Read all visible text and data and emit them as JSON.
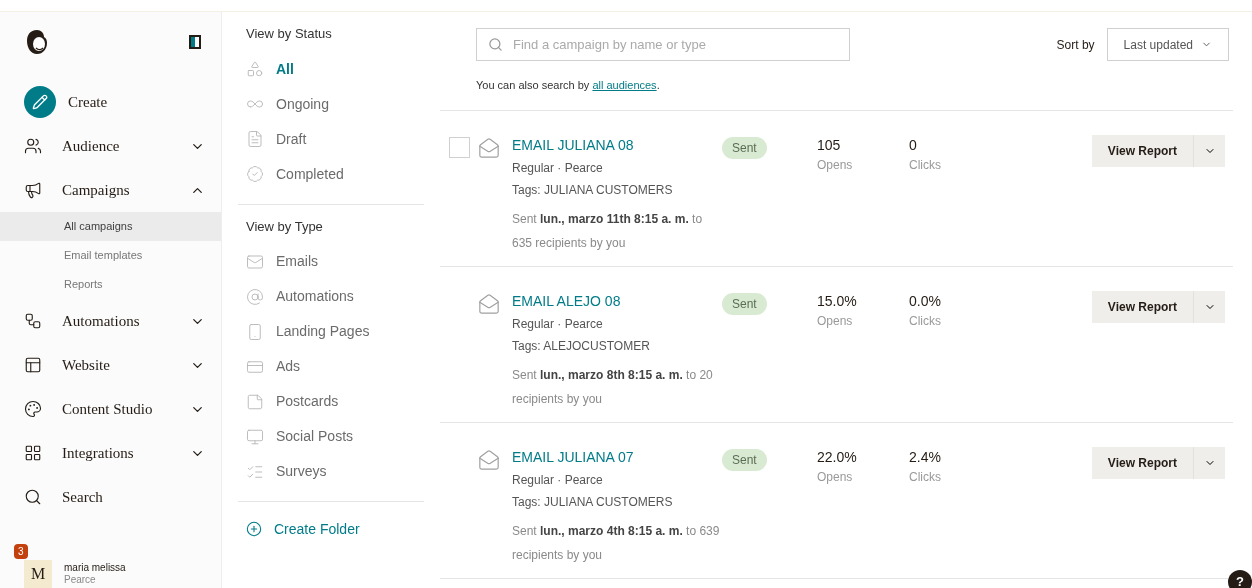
{
  "sidebar": {
    "nav": [
      {
        "kind": "create",
        "label": "Create"
      },
      {
        "kind": "group",
        "label": "Audience",
        "expanded": false
      },
      {
        "kind": "group",
        "label": "Campaigns",
        "expanded": true,
        "children": [
          {
            "label": "All campaigns",
            "selected": true
          },
          {
            "label": "Email templates",
            "selected": false
          },
          {
            "label": "Reports",
            "selected": false
          }
        ]
      },
      {
        "kind": "group",
        "label": "Automations",
        "expanded": false
      },
      {
        "kind": "group",
        "label": "Website",
        "expanded": false
      },
      {
        "kind": "group",
        "label": "Content Studio",
        "expanded": false
      },
      {
        "kind": "group",
        "label": "Integrations",
        "expanded": false
      },
      {
        "kind": "link",
        "label": "Search"
      }
    ],
    "user": {
      "initial": "M",
      "badge": "3",
      "name": "maria melissa",
      "org": "Pearce"
    }
  },
  "filters": {
    "status_heading": "View by Status",
    "status": [
      {
        "label": "All",
        "selected": true
      },
      {
        "label": "Ongoing",
        "selected": false
      },
      {
        "label": "Draft",
        "selected": false
      },
      {
        "label": "Completed",
        "selected": false
      }
    ],
    "type_heading": "View by Type",
    "types": [
      {
        "label": "Emails",
        "selected": false
      },
      {
        "label": "Automations",
        "selected": false
      },
      {
        "label": "Landing Pages",
        "selected": false
      },
      {
        "label": "Ads",
        "selected": false
      },
      {
        "label": "Postcards",
        "selected": false
      },
      {
        "label": "Social Posts",
        "selected": false
      },
      {
        "label": "Surveys",
        "selected": false
      }
    ],
    "create_folder": "Create Folder"
  },
  "main": {
    "search": {
      "placeholder": "Find a campaign by name or type"
    },
    "hint": "You can also search by ",
    "hint_link": "all audiences",
    "hint_end": ".",
    "sort_label": "Sort by",
    "sort_value": "Last updated",
    "campaigns": [
      {
        "name": "EMAIL JULIANA 08",
        "checked": false,
        "status": "Sent",
        "meta": "Regular · Pearce",
        "tags": "Tags: JULIANA CUSTOMERS",
        "sent": "Sent **lun., marzo 11th 8:15 a. m.** to 635 recipients by you",
        "opens": "105",
        "opens_label": "Opens",
        "clicks": "0",
        "clicks_label": "Clicks",
        "action": "View Report"
      },
      {
        "name": "EMAIL ALEJO 08",
        "status": "Sent",
        "meta": "Regular · Pearce",
        "tags": "Tags: ALEJOCUSTOMER",
        "sent": "Sent **lun., marzo 8th 8:15 a. m.** to 20 recipients by you",
        "opens": "15.0%",
        "opens_label": "Opens",
        "clicks": "0.0%",
        "clicks_label": "Clicks",
        "action": "View Report"
      },
      {
        "name": "EMAIL JULIANA 07",
        "status": "Sent",
        "meta": "Regular · Pearce",
        "tags": "Tags: JULIANA CUSTOMERS",
        "sent": "Sent **lun., marzo 4th 8:15 a. m.** to 639 recipients by you",
        "opens": "22.0%",
        "opens_label": "Opens",
        "clicks": "2.4%",
        "clicks_label": "Clicks",
        "action": "View Report"
      }
    ],
    "help": "?"
  }
}
